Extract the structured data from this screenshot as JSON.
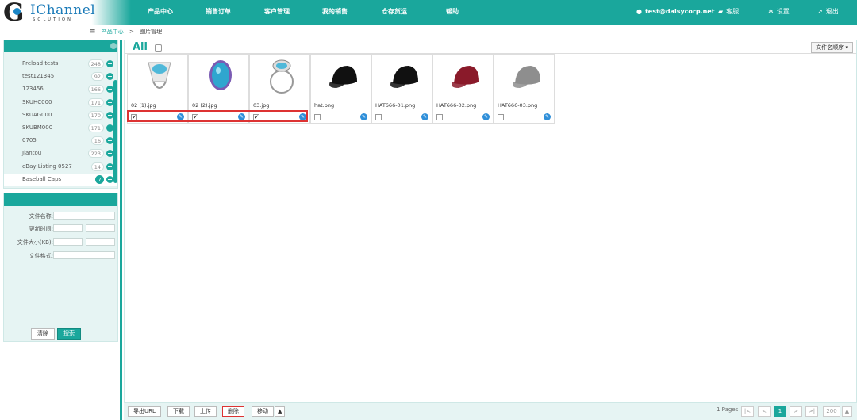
{
  "logo": {
    "title": "IChannel",
    "subtitle": "SOLUTION",
    "initial": "G"
  },
  "nav": {
    "items": [
      "产品中心",
      "销售订单",
      "客户管理",
      "我的销售",
      "仓存货运",
      "帮助"
    ],
    "user": "test@daisycorp.net",
    "service": "客服",
    "settings": "设置",
    "logout": "退出"
  },
  "breadcrumb": {
    "home": "产品中心",
    "separator": ">",
    "current": "图片管理"
  },
  "categories": [
    {
      "label": "Preload tests",
      "count": "248"
    },
    {
      "label": "test121345",
      "count": "92"
    },
    {
      "label": "123456",
      "count": "166"
    },
    {
      "label": "SKUHC000",
      "count": "171"
    },
    {
      "label": "SKUAG000",
      "count": "170"
    },
    {
      "label": "SKUBM000",
      "count": "171"
    },
    {
      "label": "0705",
      "count": "16"
    },
    {
      "label": "Jiantou",
      "count": "223"
    },
    {
      "label": "eBay Listing 0527",
      "count": "14"
    },
    {
      "label": "Baseball Caps",
      "count": "7"
    }
  ],
  "filters": {
    "file_name": "文件名称:",
    "update_time": "更新时间:",
    "file_size": "文件大小(KB):",
    "file_format": "文件格式:",
    "clear": "清除",
    "search": "搜索"
  },
  "main": {
    "all_label": "All",
    "sort": "文件名顺序 ▾"
  },
  "images": [
    {
      "name": "02 (1).jpg",
      "checked": "✔",
      "kind": "ring-white"
    },
    {
      "name": "02 (2).jpg",
      "checked": "✔",
      "kind": "ring-blue"
    },
    {
      "name": "03.jpg",
      "checked": "✔",
      "kind": "ring-oval"
    },
    {
      "name": "hat.png",
      "checked": "",
      "kind": "hat-black"
    },
    {
      "name": "HAT666-01.png",
      "checked": "",
      "kind": "hat-black"
    },
    {
      "name": "HAT666-02.png",
      "checked": "",
      "kind": "hat-red"
    },
    {
      "name": "HAT666-03.png",
      "checked": "",
      "kind": "hat-grey"
    }
  ],
  "toolbar": {
    "export": "导出URL",
    "download": "下载",
    "upload": "上传",
    "delete": "删除",
    "move": "移动",
    "up": "▲"
  },
  "pager": {
    "pages": "1 Pages",
    "first": "|<",
    "prev": "<",
    "current": "1",
    "next": ">",
    "last": ">|",
    "per_page": "200",
    "per_page_arrow": "▲"
  },
  "colors": {
    "brand": "#1aa79c",
    "edit_icon": "#2f8fd9",
    "selection": "#dd3333"
  }
}
